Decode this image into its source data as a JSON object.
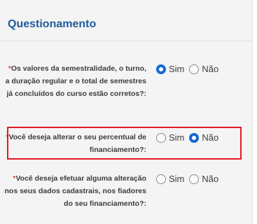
{
  "section": {
    "title": "Questionamento"
  },
  "questions": [
    {
      "required_mark": "*",
      "label": "Os valores da semestralidade, o turno, a duração regular e o total de semestres já concluídos do curso estão corretos?:",
      "options": [
        {
          "label": "Sim",
          "checked": true
        },
        {
          "label": "Não",
          "checked": false
        }
      ]
    },
    {
      "required_mark": "*",
      "label": "Você deseja alterar o seu percentual de financiamento?:",
      "options": [
        {
          "label": "Sim",
          "checked": false
        },
        {
          "label": "Não",
          "checked": true
        }
      ]
    },
    {
      "required_mark": "*",
      "label": "Você deseja efetuar alguma alteração nos seus dados cadastrais, nos fiadores do seu financiamento?:",
      "options": [
        {
          "label": "Sim",
          "checked": false
        },
        {
          "label": "Não",
          "checked": false
        }
      ]
    }
  ],
  "colors": {
    "title": "#1f5b9b",
    "required": "#d84b3e",
    "radio_selected": "#1769d2",
    "highlight_border": "#e31b23",
    "panel_background": "#f4f4f4"
  },
  "icons": {
    "radio_selected": "radio-selected-icon",
    "radio_unselected": "radio-unselected-icon"
  }
}
